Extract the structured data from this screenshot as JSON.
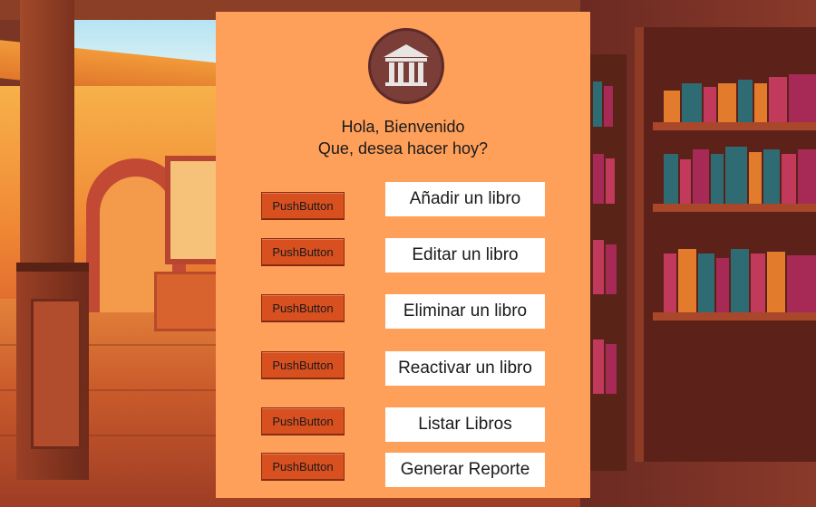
{
  "panel": {
    "logo_icon": "museum-building-icon",
    "greeting_line1": "Hola, Bienvenido",
    "greeting_line2": "Que, desea hacer hoy?"
  },
  "actions": [
    {
      "push_label": "PushButton",
      "label": "Añadir un libro"
    },
    {
      "push_label": "PushButton",
      "label": "Editar un libro"
    },
    {
      "push_label": "PushButton",
      "label": "Eliminar un libro"
    },
    {
      "push_label": "PushButton",
      "label": "Reactivar un libro"
    },
    {
      "push_label": "PushButton",
      "label": "Listar Libros"
    },
    {
      "push_label": "PushButton",
      "label": "Generar Reporte"
    }
  ],
  "colors": {
    "panel_bg": "#fe9f5a",
    "push_button_bg": "#d8501f",
    "action_button_bg": "#ffffff",
    "logo_bg": "#7a3d38"
  }
}
